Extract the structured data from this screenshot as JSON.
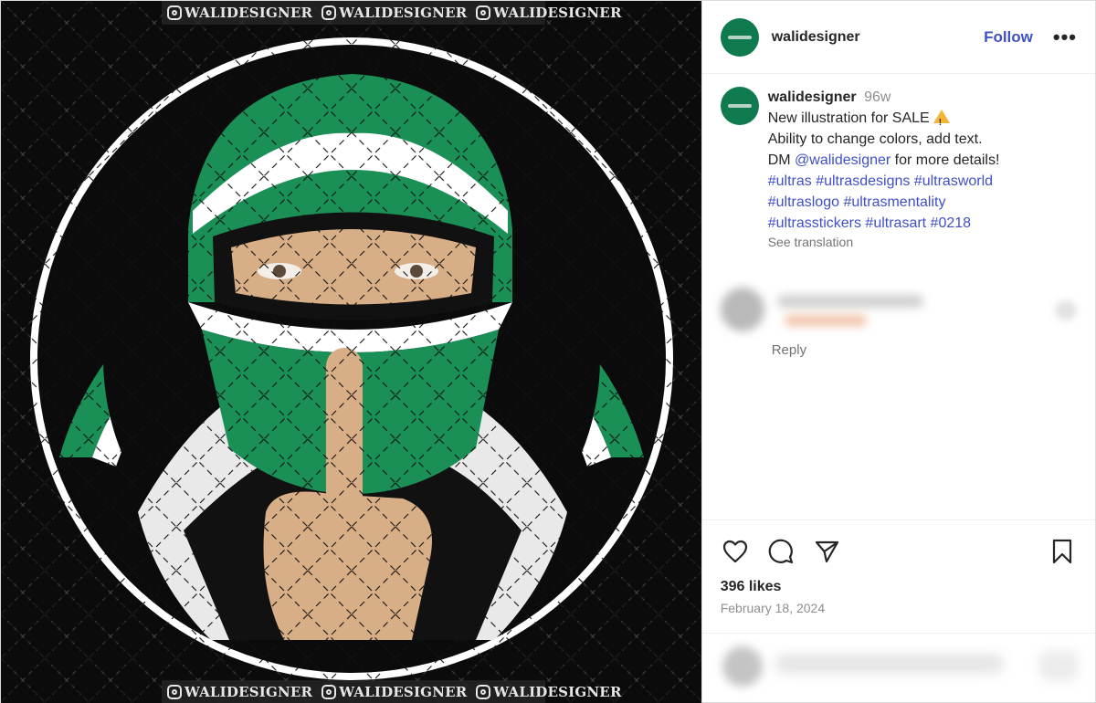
{
  "media": {
    "watermark": [
      "WALIDESIGNER",
      "WALIDESIGNER",
      "WALIDESIGNER"
    ],
    "colors": {
      "green": "#1a8f56",
      "white": "#ffffff",
      "skin": "#d8ae86",
      "background": "#0b0b0b"
    }
  },
  "header": {
    "username": "walidesigner",
    "follow_label": "Follow",
    "more_icon": "more-horizontal-icon"
  },
  "caption": {
    "username": "walidesigner",
    "time": "96w",
    "line1": "New illustration for SALE",
    "line2": "Ability to change colors, add text.",
    "line3_prefix": "DM ",
    "mention": "@walidesigner",
    "line3_suffix": " for more details!",
    "hashtags_line1": "#ultras #ultrasdesigns #ultrasworld",
    "hashtags_line2": "#ultraslogo #ultrasmentality",
    "hashtags_line3": "#ultrasstickers #ultrasart #0218",
    "see_translation": "See translation"
  },
  "comment": {
    "reply_label": "Reply"
  },
  "actions": {
    "icons": [
      "heart-icon",
      "comment-icon",
      "share-icon",
      "bookmark-icon"
    ],
    "likes": "396 likes",
    "date": "February 18, 2024"
  },
  "theme": {
    "link": "#4150c7",
    "muted": "#8e8e8e"
  }
}
